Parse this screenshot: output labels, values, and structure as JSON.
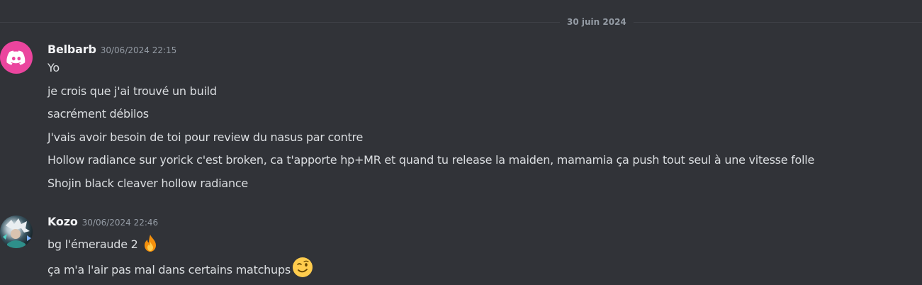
{
  "divider": {
    "date": "30 juin 2024"
  },
  "messages": [
    {
      "username": "Belbarb",
      "timestamp": "30/06/2024 22:15",
      "avatar_icon": "discord-logo-icon",
      "lines": [
        "Yo",
        "je crois que j'ai trouvé un build",
        "sacrément débilos",
        "J'vais avoir besoin de toi pour review du nasus par contre",
        "Hollow radiance sur yorick c'est broken, ca t'apporte hp+MR et quand tu release la maiden, mamamia ça push tout seul à une vitesse folle",
        "Shojin black cleaver hollow radiance"
      ]
    },
    {
      "username": "Kozo",
      "timestamp": "30/06/2024 22:46",
      "avatar_icon": "anime-avatar-image",
      "lines": [
        "bg l'émeraude 2",
        "ça m'a l'air pas mal dans certains matchups"
      ],
      "emojis": [
        "fire-emoji",
        "winking-face-emoji"
      ]
    }
  ],
  "colors": {
    "background": "#313338",
    "username": "#f2f3f5",
    "timestamp": "#949ba4",
    "message_text": "#dbdee1",
    "belbarb_avatar": "#eb459e"
  }
}
